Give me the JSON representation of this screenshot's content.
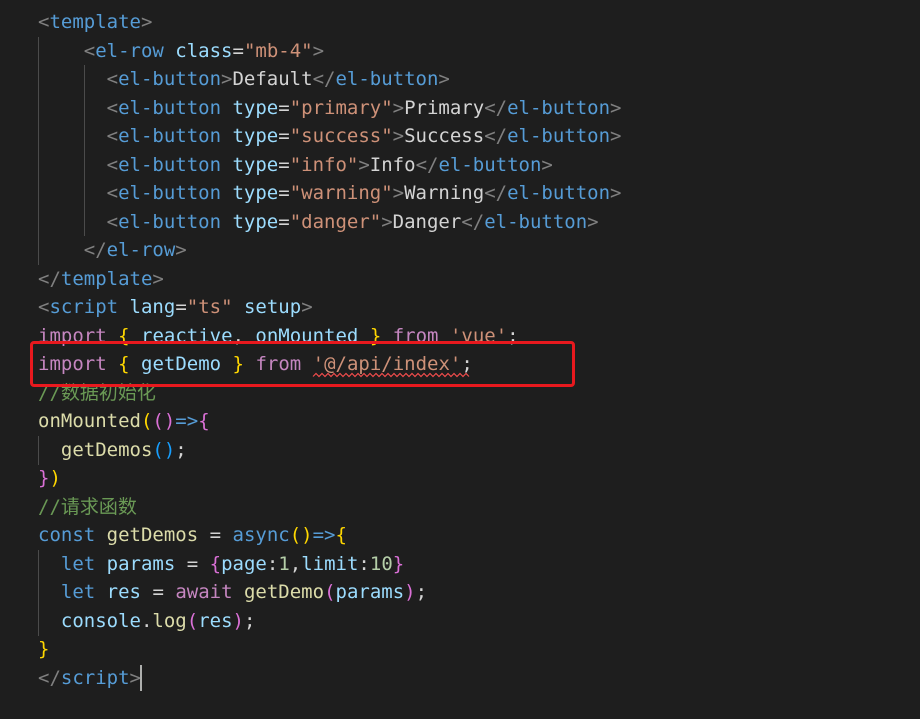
{
  "editor": {
    "lines": [
      {
        "tokens": [
          {
            "t": "<",
            "k": "punct"
          },
          {
            "t": "template",
            "k": "tag"
          },
          {
            "t": ">",
            "k": "punct"
          }
        ]
      },
      {
        "tokens": [
          {
            "t": "    <",
            "k": "punct"
          },
          {
            "t": "el-row",
            "k": "tag"
          },
          {
            "t": " ",
            "k": "text"
          },
          {
            "t": "class",
            "k": "attr"
          },
          {
            "t": "=",
            "k": "text"
          },
          {
            "t": "\"mb-4\"",
            "k": "string"
          },
          {
            "t": ">",
            "k": "punct"
          }
        ]
      },
      {
        "tokens": [
          {
            "t": "      <",
            "k": "punct"
          },
          {
            "t": "el-button",
            "k": "tag"
          },
          {
            "t": ">",
            "k": "punct"
          },
          {
            "t": "Default",
            "k": "text"
          },
          {
            "t": "</",
            "k": "punct"
          },
          {
            "t": "el-button",
            "k": "tag"
          },
          {
            "t": ">",
            "k": "punct"
          }
        ]
      },
      {
        "tokens": [
          {
            "t": "      <",
            "k": "punct"
          },
          {
            "t": "el-button",
            "k": "tag"
          },
          {
            "t": " ",
            "k": "text"
          },
          {
            "t": "type",
            "k": "attr"
          },
          {
            "t": "=",
            "k": "text"
          },
          {
            "t": "\"primary\"",
            "k": "string"
          },
          {
            "t": ">",
            "k": "punct"
          },
          {
            "t": "Primary",
            "k": "text"
          },
          {
            "t": "</",
            "k": "punct"
          },
          {
            "t": "el-button",
            "k": "tag"
          },
          {
            "t": ">",
            "k": "punct"
          }
        ]
      },
      {
        "tokens": [
          {
            "t": "      <",
            "k": "punct"
          },
          {
            "t": "el-button",
            "k": "tag"
          },
          {
            "t": " ",
            "k": "text"
          },
          {
            "t": "type",
            "k": "attr"
          },
          {
            "t": "=",
            "k": "text"
          },
          {
            "t": "\"success\"",
            "k": "string"
          },
          {
            "t": ">",
            "k": "punct"
          },
          {
            "t": "Success",
            "k": "text"
          },
          {
            "t": "</",
            "k": "punct"
          },
          {
            "t": "el-button",
            "k": "tag"
          },
          {
            "t": ">",
            "k": "punct"
          }
        ]
      },
      {
        "tokens": [
          {
            "t": "      <",
            "k": "punct"
          },
          {
            "t": "el-button",
            "k": "tag"
          },
          {
            "t": " ",
            "k": "text"
          },
          {
            "t": "type",
            "k": "attr"
          },
          {
            "t": "=",
            "k": "text"
          },
          {
            "t": "\"info\"",
            "k": "string"
          },
          {
            "t": ">",
            "k": "punct"
          },
          {
            "t": "Info",
            "k": "text"
          },
          {
            "t": "</",
            "k": "punct"
          },
          {
            "t": "el-button",
            "k": "tag"
          },
          {
            "t": ">",
            "k": "punct"
          }
        ]
      },
      {
        "tokens": [
          {
            "t": "      <",
            "k": "punct"
          },
          {
            "t": "el-button",
            "k": "tag"
          },
          {
            "t": " ",
            "k": "text"
          },
          {
            "t": "type",
            "k": "attr"
          },
          {
            "t": "=",
            "k": "text"
          },
          {
            "t": "\"warning\"",
            "k": "string"
          },
          {
            "t": ">",
            "k": "punct"
          },
          {
            "t": "Warning",
            "k": "text"
          },
          {
            "t": "</",
            "k": "punct"
          },
          {
            "t": "el-button",
            "k": "tag"
          },
          {
            "t": ">",
            "k": "punct"
          }
        ]
      },
      {
        "tokens": [
          {
            "t": "      <",
            "k": "punct"
          },
          {
            "t": "el-button",
            "k": "tag"
          },
          {
            "t": " ",
            "k": "text"
          },
          {
            "t": "type",
            "k": "attr"
          },
          {
            "t": "=",
            "k": "text"
          },
          {
            "t": "\"danger\"",
            "k": "string"
          },
          {
            "t": ">",
            "k": "punct"
          },
          {
            "t": "Danger",
            "k": "text"
          },
          {
            "t": "</",
            "k": "punct"
          },
          {
            "t": "el-button",
            "k": "tag"
          },
          {
            "t": ">",
            "k": "punct"
          }
        ]
      },
      {
        "tokens": [
          {
            "t": "    </",
            "k": "punct"
          },
          {
            "t": "el-row",
            "k": "tag"
          },
          {
            "t": ">",
            "k": "punct"
          }
        ]
      },
      {
        "tokens": [
          {
            "t": "</",
            "k": "punct"
          },
          {
            "t": "template",
            "k": "tag"
          },
          {
            "t": ">",
            "k": "punct"
          }
        ]
      },
      {
        "tokens": [
          {
            "t": "<",
            "k": "punct"
          },
          {
            "t": "script",
            "k": "tag"
          },
          {
            "t": " ",
            "k": "text"
          },
          {
            "t": "lang",
            "k": "attr"
          },
          {
            "t": "=",
            "k": "text"
          },
          {
            "t": "\"ts\"",
            "k": "string"
          },
          {
            "t": " ",
            "k": "text"
          },
          {
            "t": "setup",
            "k": "attr"
          },
          {
            "t": ">",
            "k": "punct"
          }
        ]
      },
      {
        "tokens": [
          {
            "t": "import",
            "k": "control"
          },
          {
            "t": " ",
            "k": "text"
          },
          {
            "t": "{",
            "k": "bracket1"
          },
          {
            "t": " ",
            "k": "text"
          },
          {
            "t": "reactive",
            "k": "variable"
          },
          {
            "t": ", ",
            "k": "text"
          },
          {
            "t": "onMounted",
            "k": "variable"
          },
          {
            "t": " ",
            "k": "text"
          },
          {
            "t": "}",
            "k": "bracket1"
          },
          {
            "t": " ",
            "k": "text"
          },
          {
            "t": "from",
            "k": "control"
          },
          {
            "t": " ",
            "k": "text"
          },
          {
            "t": "'vue'",
            "k": "string"
          },
          {
            "t": ";",
            "k": "text"
          }
        ]
      },
      {
        "tokens": [
          {
            "t": "import",
            "k": "control"
          },
          {
            "t": " ",
            "k": "text"
          },
          {
            "t": "{",
            "k": "bracket1"
          },
          {
            "t": " ",
            "k": "text"
          },
          {
            "t": "getDemo",
            "k": "variable"
          },
          {
            "t": " ",
            "k": "text"
          },
          {
            "t": "}",
            "k": "bracket1"
          },
          {
            "t": " ",
            "k": "text"
          },
          {
            "t": "from",
            "k": "control"
          },
          {
            "t": " ",
            "k": "text"
          },
          {
            "t": "'@/api/index'",
            "k": "string"
          },
          {
            "t": ";",
            "k": "text"
          }
        ]
      },
      {
        "tokens": [
          {
            "t": "//数据初始化",
            "k": "comment"
          }
        ]
      },
      {
        "tokens": [
          {
            "t": "onMounted",
            "k": "function"
          },
          {
            "t": "(",
            "k": "bracket1"
          },
          {
            "t": "()",
            "k": "bracket2"
          },
          {
            "t": "=>",
            "k": "storage"
          },
          {
            "t": "{",
            "k": "bracket2"
          }
        ]
      },
      {
        "tokens": [
          {
            "t": "  ",
            "k": "text"
          },
          {
            "t": "getDemos",
            "k": "function"
          },
          {
            "t": "()",
            "k": "bracket3"
          },
          {
            "t": ";",
            "k": "text"
          }
        ]
      },
      {
        "tokens": [
          {
            "t": "}",
            "k": "bracket2"
          },
          {
            "t": ")",
            "k": "bracket1"
          }
        ]
      },
      {
        "tokens": [
          {
            "t": "//请求函数",
            "k": "comment"
          }
        ]
      },
      {
        "tokens": [
          {
            "t": "const",
            "k": "storage"
          },
          {
            "t": " ",
            "k": "text"
          },
          {
            "t": "getDemos",
            "k": "function"
          },
          {
            "t": " = ",
            "k": "text"
          },
          {
            "t": "async",
            "k": "storage"
          },
          {
            "t": "()",
            "k": "bracket1"
          },
          {
            "t": "=>",
            "k": "storage"
          },
          {
            "t": "{",
            "k": "bracket1"
          }
        ]
      },
      {
        "tokens": [
          {
            "t": "  ",
            "k": "text"
          },
          {
            "t": "let",
            "k": "storage"
          },
          {
            "t": " ",
            "k": "text"
          },
          {
            "t": "params",
            "k": "variable"
          },
          {
            "t": " = ",
            "k": "text"
          },
          {
            "t": "{",
            "k": "bracket2"
          },
          {
            "t": "page",
            "k": "variable"
          },
          {
            "t": ":",
            "k": "text"
          },
          {
            "t": "1",
            "k": "number"
          },
          {
            "t": ",",
            "k": "text"
          },
          {
            "t": "limit",
            "k": "variable"
          },
          {
            "t": ":",
            "k": "text"
          },
          {
            "t": "10",
            "k": "number"
          },
          {
            "t": "}",
            "k": "bracket2"
          }
        ]
      },
      {
        "tokens": [
          {
            "t": "  ",
            "k": "text"
          },
          {
            "t": "let",
            "k": "storage"
          },
          {
            "t": " ",
            "k": "text"
          },
          {
            "t": "res",
            "k": "variable"
          },
          {
            "t": " = ",
            "k": "text"
          },
          {
            "t": "await",
            "k": "control"
          },
          {
            "t": " ",
            "k": "text"
          },
          {
            "t": "getDemo",
            "k": "function"
          },
          {
            "t": "(",
            "k": "bracket2"
          },
          {
            "t": "params",
            "k": "variable"
          },
          {
            "t": ")",
            "k": "bracket2"
          },
          {
            "t": ";",
            "k": "text"
          }
        ]
      },
      {
        "tokens": [
          {
            "t": "  ",
            "k": "text"
          },
          {
            "t": "console",
            "k": "variable"
          },
          {
            "t": ".",
            "k": "text"
          },
          {
            "t": "log",
            "k": "function"
          },
          {
            "t": "(",
            "k": "bracket2"
          },
          {
            "t": "res",
            "k": "variable"
          },
          {
            "t": ")",
            "k": "bracket2"
          },
          {
            "t": ";",
            "k": "text"
          }
        ]
      },
      {
        "tokens": [
          {
            "t": "}",
            "k": "bracket1"
          }
        ]
      },
      {
        "tokens": [
          {
            "t": "</",
            "k": "punct"
          },
          {
            "t": "script",
            "k": "tag"
          },
          {
            "t": ">",
            "k": "punct"
          }
        ]
      }
    ]
  },
  "colors": {
    "punct": "#808080",
    "tag": "#569cd6",
    "attr": "#9cdcfe",
    "text": "#d4d4d4",
    "string": "#ce9178",
    "control": "#c586c0",
    "variable": "#9cdcfe",
    "function": "#dcdcaa",
    "comment": "#6a9955",
    "number": "#b5cea8",
    "storage": "#569cd6",
    "bracket1": "#ffd700",
    "bracket2": "#da70d6",
    "bracket3": "#179fff"
  },
  "theme": {
    "background": "#1e1e1e",
    "highlight_box": "#e8191e",
    "error_squiggle": "#f14c4c",
    "cursor": "#aeafad",
    "indent_guide": "#4b4b4b"
  }
}
